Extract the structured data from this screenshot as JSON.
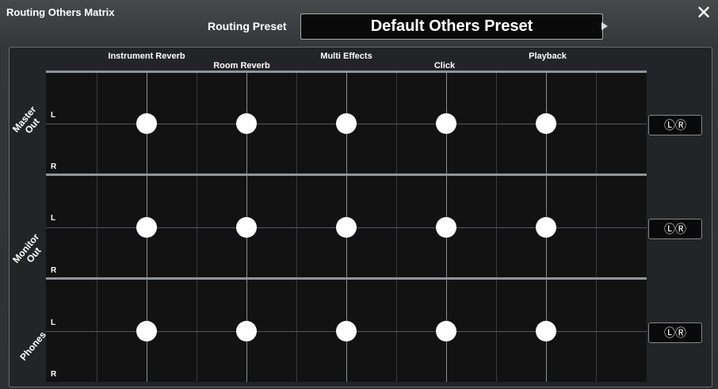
{
  "window": {
    "title": "Routing Others Matrix",
    "close_icon": "close-icon"
  },
  "preset": {
    "label": "Routing Preset",
    "value": "Default Others Preset"
  },
  "sources": [
    "Instrument Reverb",
    "Room Reverb",
    "Multi Effects",
    "Click",
    "Playback"
  ],
  "outputs": [
    {
      "name": "Master\nOut",
      "left": "L",
      "right": "R",
      "button": "ⓁⓇ"
    },
    {
      "name": "Monitor\nOut",
      "left": "L",
      "right": "R",
      "button": "ⓁⓇ"
    },
    {
      "name": "Phones",
      "left": "L",
      "right": "R",
      "button": "ⓁⓇ"
    }
  ],
  "colors": {
    "node": "#ffffff",
    "separator": "#8f959e"
  }
}
